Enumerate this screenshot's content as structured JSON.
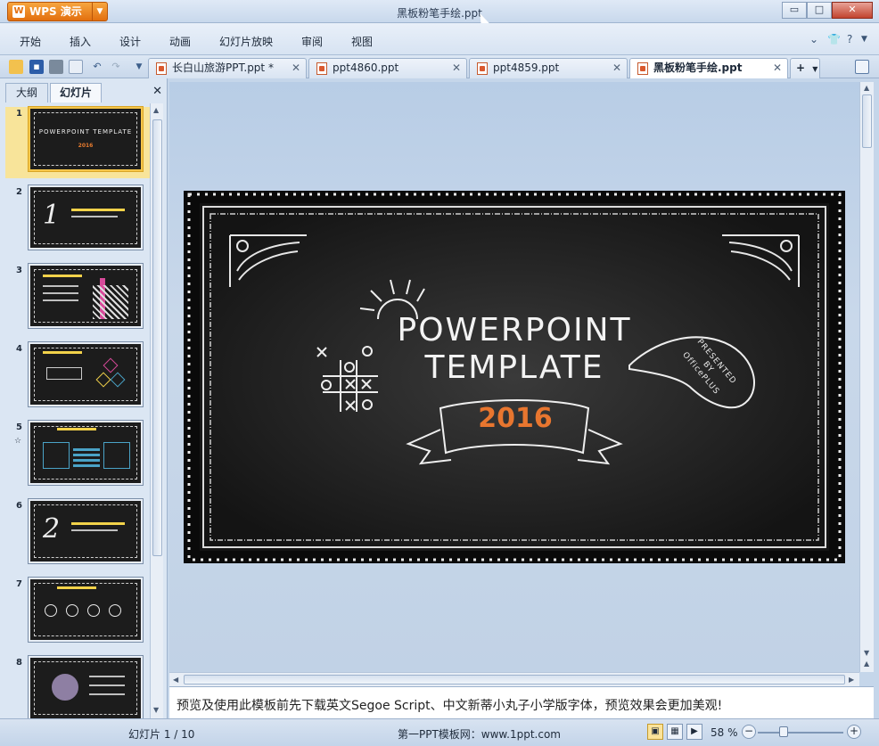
{
  "app": {
    "button_label": "WPS 演示",
    "logo_glyph": "W",
    "accent": "#e36f0e"
  },
  "window": {
    "title": "黑板粉笔手绘.ppt",
    "controls": [
      "▭",
      "□",
      "✕"
    ]
  },
  "menu": [
    "开始",
    "插入",
    "设计",
    "动画",
    "幻灯片放映",
    "审阅",
    "视图"
  ],
  "tabs": [
    {
      "label": "长白山旅游PPT.ppt *",
      "active": false
    },
    {
      "label": "ppt4860.ppt",
      "active": false
    },
    {
      "label": "ppt4859.ppt",
      "active": false
    },
    {
      "label": "黑板粉笔手绘.ppt",
      "active": true
    }
  ],
  "new_tab_label": "+",
  "left_pane": {
    "tabs": [
      "大纲",
      "幻灯片"
    ],
    "active_tab": "幻灯片",
    "close": "✕",
    "slides": [
      {
        "num": "1",
        "selected": true,
        "kind": "title",
        "title": "POWERPOINT TEMPLATE",
        "sub": "2016"
      },
      {
        "num": "2",
        "kind": "section",
        "big": "1"
      },
      {
        "num": "3",
        "kind": "bars"
      },
      {
        "num": "4",
        "kind": "hex"
      },
      {
        "num": "5",
        "kind": "boxes",
        "star": "☆"
      },
      {
        "num": "6",
        "kind": "section",
        "big": "2"
      },
      {
        "num": "7",
        "kind": "circles"
      },
      {
        "num": "8",
        "kind": "people"
      }
    ]
  },
  "slide": {
    "title_line1": "POWERPOINT",
    "title_line2": "TEMPLATE",
    "year": "2016",
    "bubble": "PRESENTED BY OfficePLUS",
    "year_color": "#e8762f"
  },
  "notes": "预览及使用此模板前先下载英文Segoe Script、中文新蒂小丸子小学版字体，预览效果会更加美观!",
  "status": {
    "slide_counter": "幻灯片 1 / 10",
    "center": "第一PPT模板网：www.1ppt.com",
    "zoom": "58 %"
  }
}
